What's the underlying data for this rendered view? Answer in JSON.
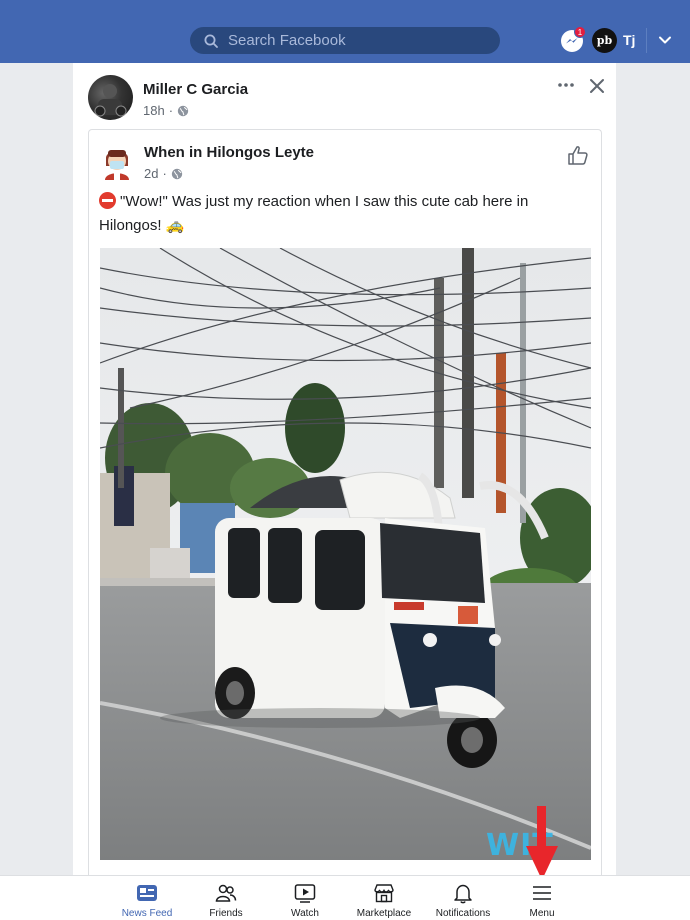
{
  "topbar": {
    "search_placeholder": "Search Facebook",
    "messenger_badge": "1",
    "avatar_initials": "pb",
    "user_name": "Tj"
  },
  "post": {
    "author": "Miller C Garcia",
    "time": "18h",
    "shared": {
      "title": "When in Hilongos Leyte",
      "time": "2d",
      "text": "\"Wow!\" Was just my reaction when I saw this cute cab here in Hilongos! 🚕"
    }
  },
  "watermark": "WIT",
  "nav": {
    "items": [
      {
        "label": "News Feed",
        "icon": "news-feed-icon",
        "active": true
      },
      {
        "label": "Friends",
        "icon": "friends-icon"
      },
      {
        "label": "Watch",
        "icon": "watch-icon"
      },
      {
        "label": "Marketplace",
        "icon": "marketplace-icon"
      },
      {
        "label": "Notifications",
        "icon": "bell-icon"
      },
      {
        "label": "Menu",
        "icon": "hamburger-icon"
      }
    ]
  },
  "colors": {
    "brand": "#4267b2",
    "search_bg": "#29487d",
    "badge": "#e41e3f",
    "arrow": "#e8262b",
    "watermark": "#38b8e8"
  }
}
